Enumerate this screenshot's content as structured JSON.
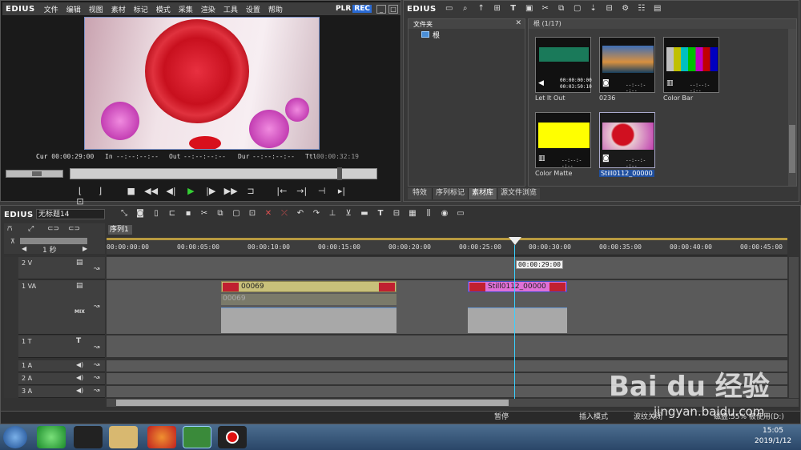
{
  "player": {
    "logo": "EDIUS",
    "menu": [
      "文件",
      "编辑",
      "视图",
      "素材",
      "标记",
      "模式",
      "采集",
      "渲染",
      "工具",
      "设置",
      "帮助"
    ],
    "plr": "PLR",
    "rec": "REC",
    "timecodes": {
      "cur_label": "Cur",
      "cur": "00:00:29:00",
      "in_label": "In",
      "in": "--:--:--:--",
      "out_label": "Out",
      "out": "--:--:--:--",
      "dur_label": "Dur",
      "dur": "--:--:--:--",
      "ttl_label": "Ttl",
      "ttl": "00:00:32:19"
    }
  },
  "bin": {
    "logo": "EDIUS",
    "folder_panel_title": "文件夹",
    "root_label": "根",
    "path_label": "根 (1/17)",
    "clips": [
      {
        "name": "Let It Out",
        "tc1": "00:00:00:00",
        "tc2": "00:03:50:10"
      },
      {
        "name": "0236",
        "tc1": "",
        "tc2": "--:--:--:--"
      },
      {
        "name": "Color Bar",
        "tc1": "",
        "tc2": "--:--:--:--"
      },
      {
        "name": "Color Matte",
        "tc1": "",
        "tc2": "--:--:--:--"
      },
      {
        "name": "Still0112_00000",
        "tc1": "",
        "tc2": "--:--:--:--"
      }
    ],
    "tabs": [
      "特效",
      "序列标记",
      "素材库",
      "源文件浏览"
    ]
  },
  "timeline": {
    "logo": "EDIUS",
    "project_name": "无标题14",
    "sequence_tab": "序列1",
    "scale_label": "1 秒",
    "ruler_ticks": [
      "00:00:00:00",
      "00:00:05:00",
      "00:00:10:00",
      "00:00:15:00",
      "00:00:20:00",
      "00:00:25:00",
      "00:00:30:00",
      "00:00:35:00",
      "00:00:40:00",
      "00:00:45:00"
    ],
    "playhead_tc": "00:00:29:00",
    "tracks": [
      {
        "name": "2 V"
      },
      {
        "name": "1 VA",
        "mix": "MIX"
      },
      {
        "name": "1 T"
      },
      {
        "name": "1 A"
      },
      {
        "name": "2 A"
      },
      {
        "name": "3 A"
      }
    ],
    "clips": [
      {
        "name": "00069",
        "audio_name": "00069"
      },
      {
        "name": "Still0112_00000"
      }
    ]
  },
  "status": {
    "pause": "暂停",
    "insert_mode": "插入模式",
    "ripple": "波纹关闭",
    "disk": "磁盘:55% 被使用(D:)"
  },
  "taskbar": {
    "time": "15:05",
    "date": "2019/1/12"
  },
  "watermark": {
    "brand": "Bai du 经验",
    "url": "jingyan.baidu.com"
  }
}
